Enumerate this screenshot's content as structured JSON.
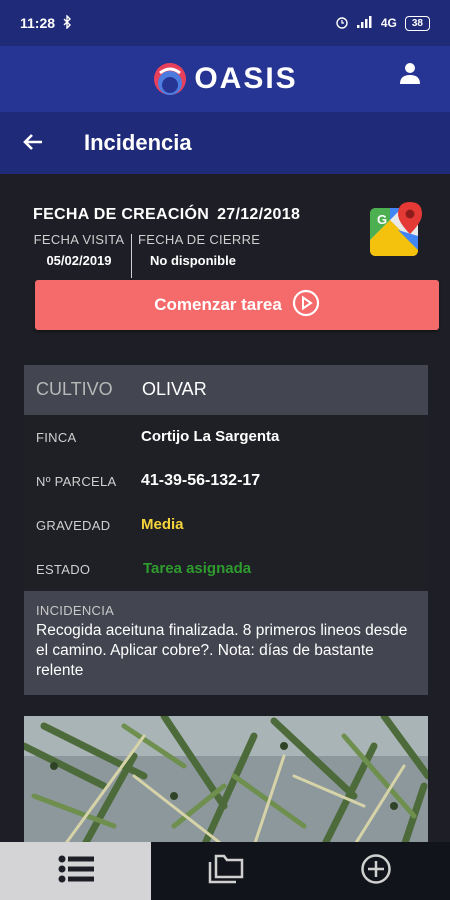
{
  "status_bar": {
    "time": "11:28",
    "network": "4G",
    "battery": "38"
  },
  "app": {
    "name": "OASIS"
  },
  "header": {
    "title": "Incidencia"
  },
  "dates": {
    "creation_label": "FECHA DE CREACIÓN",
    "creation_value": "27/12/2018",
    "visit_label": "FECHA VISITA",
    "visit_value": "05/02/2019",
    "close_label": "FECHA DE CIERRE",
    "close_value": "No disponible"
  },
  "start_button": {
    "label": "Comenzar tarea"
  },
  "details": {
    "crop_label": "CULTIVO",
    "crop_value": "OLIVAR",
    "farm_label": "FINCA",
    "farm_value": "Cortijo La Sargenta",
    "plot_label": "Nº PARCELA",
    "plot_value": "41-39-56-132-17",
    "severity_label": "GRAVEDAD",
    "severity_value": "Media",
    "status_label": "ESTADO",
    "status_value": "Tarea asignada"
  },
  "incident": {
    "label": "INCIDENCIA",
    "text": "Recogida aceituna finalizada. 8 primeros lineos desde el camino. Aplicar cobre?. Nota: días de bastante relente"
  },
  "colors": {
    "status_bar": "#1f2a78",
    "app_bar": "#263593",
    "accent_button": "#f56a6a",
    "severity": "#f5d33b",
    "status": "#2e9b2e",
    "background": "#1e1f26"
  },
  "tabs": [
    {
      "icon": "list-icon",
      "active": true
    },
    {
      "icon": "folder-icon",
      "active": false
    },
    {
      "icon": "add-circle-icon",
      "active": false
    }
  ]
}
